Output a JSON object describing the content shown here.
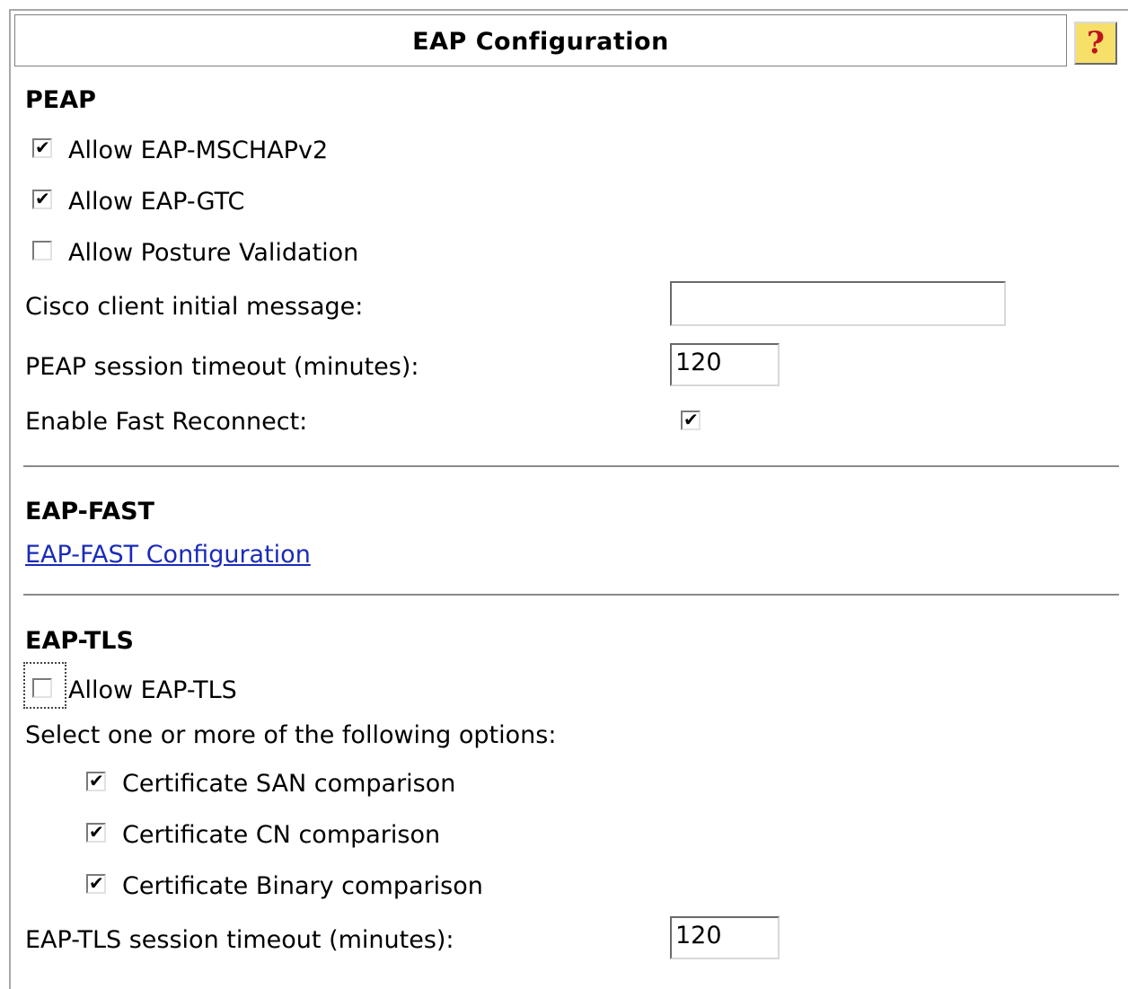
{
  "header": {
    "title": "EAP Configuration",
    "help_glyph": "?"
  },
  "peap": {
    "title": "PEAP",
    "allow_mschapv2": {
      "label": "Allow EAP-MSCHAPv2",
      "checked": true
    },
    "allow_gtc": {
      "label": "Allow EAP-GTC",
      "checked": true
    },
    "allow_posture": {
      "label": "Allow Posture Validation",
      "checked": false
    },
    "cisco_initial_message": {
      "label": "Cisco client initial message:",
      "value": ""
    },
    "session_timeout": {
      "label": "PEAP session timeout (minutes):",
      "value": "120"
    },
    "fast_reconnect": {
      "label": "Enable Fast Reconnect:",
      "checked": true
    }
  },
  "eap_fast": {
    "title": "EAP-FAST",
    "config_link": "EAP-FAST Configuration"
  },
  "eap_tls": {
    "title": "EAP-TLS",
    "allow_tls": {
      "label": "Allow EAP-TLS",
      "checked": false
    },
    "options_prompt": "Select one or more of the following options:",
    "san_comparison": {
      "label": "Certificate SAN comparison",
      "checked": true
    },
    "cn_comparison": {
      "label": "Certificate CN comparison",
      "checked": true
    },
    "binary_comparison": {
      "label": "Certificate Binary comparison",
      "checked": true
    },
    "session_timeout": {
      "label": "EAP-TLS session timeout (minutes):",
      "value": "120"
    }
  },
  "colors": {
    "link": "#1a2bb8",
    "help_bg": "#f6e06a",
    "help_glyph": "#c0141c"
  }
}
